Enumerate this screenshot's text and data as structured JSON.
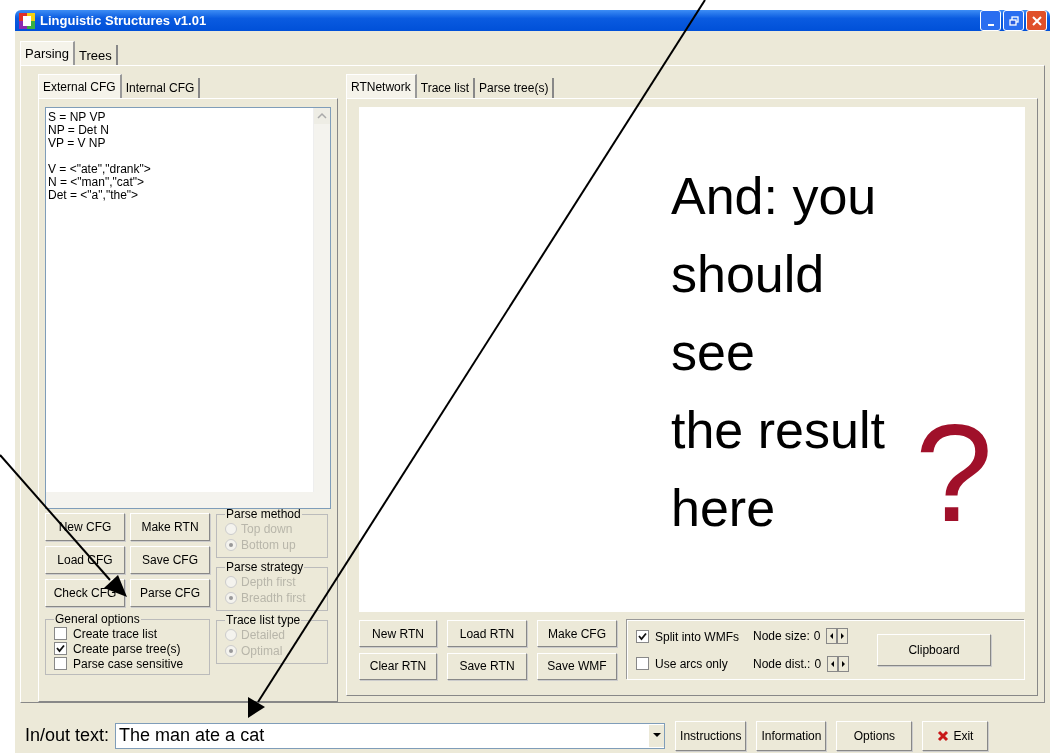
{
  "window": {
    "title": "Linguistic Structures v1.01"
  },
  "main_tabs": [
    {
      "label": "Parsing",
      "selected": true
    },
    {
      "label": "Trees",
      "selected": false
    }
  ],
  "grammar_tabs": [
    {
      "label": "External CFG",
      "selected": true
    },
    {
      "label": "Internal CFG",
      "selected": false
    }
  ],
  "grammar_text": "S = NP VP\nNP = Det N\nVP = V NP\n\nV = <\"ate\",\"drank\">\nN = <\"man\",\"cat\">\nDet = <\"a\",\"the\">",
  "grammar_buttons": [
    {
      "label": "New CFG"
    },
    {
      "label": "Make RTN"
    },
    {
      "label": "Load CFG"
    },
    {
      "label": "Save CFG"
    },
    {
      "label": "Check CFG"
    },
    {
      "label": "Parse CFG"
    }
  ],
  "general_options": {
    "title": "General options",
    "items": [
      {
        "label": "Create trace list",
        "checked": false
      },
      {
        "label": "Create parse tree(s)",
        "checked": true
      },
      {
        "label": "Parse case sensitive",
        "checked": false
      }
    ]
  },
  "radio_groups": [
    {
      "title": "Parse method",
      "disabled": true,
      "options": [
        {
          "label": "Top down",
          "selected": false
        },
        {
          "label": "Bottom up",
          "selected": true
        }
      ]
    },
    {
      "title": "Parse strategy",
      "disabled": true,
      "options": [
        {
          "label": "Depth first",
          "selected": false
        },
        {
          "label": "Breadth first",
          "selected": true
        }
      ]
    },
    {
      "title": "Trace list type",
      "disabled": true,
      "options": [
        {
          "label": "Detailed",
          "selected": false
        },
        {
          "label": "Optimal",
          "selected": true
        }
      ]
    }
  ],
  "view_tabs": [
    {
      "label": "RTNetwork",
      "selected": true
    },
    {
      "label": "Trace list",
      "selected": false
    },
    {
      "label": "Parse tree(s)",
      "selected": false
    }
  ],
  "canvas": {
    "annotation_lines": [
      "And: you",
      "should",
      "see",
      "the result",
      "here"
    ],
    "question_mark": "?"
  },
  "rtn_buttons": [
    {
      "label": "New RTN"
    },
    {
      "label": "Load RTN"
    },
    {
      "label": "Make CFG"
    },
    {
      "label": "Clear RTN"
    },
    {
      "label": "Save RTN"
    },
    {
      "label": "Save WMF"
    }
  ],
  "display_options": {
    "checkboxes": [
      {
        "label": "Split into WMFs",
        "checked": true
      },
      {
        "label": "Use arcs only",
        "checked": false
      }
    ],
    "spinners": [
      {
        "label": "Node size:",
        "value": "0"
      },
      {
        "label": "Node dist.:",
        "value": "0"
      }
    ],
    "clipboard": "Clipboard"
  },
  "io": {
    "label": "In/out text:",
    "value": "The man ate a cat"
  },
  "bottom_buttons": [
    {
      "label": "Instructions",
      "kind": "plain"
    },
    {
      "label": "Information",
      "kind": "plain"
    },
    {
      "label": "Options",
      "kind": "plain"
    },
    {
      "label": "Exit",
      "kind": "exit"
    }
  ]
}
